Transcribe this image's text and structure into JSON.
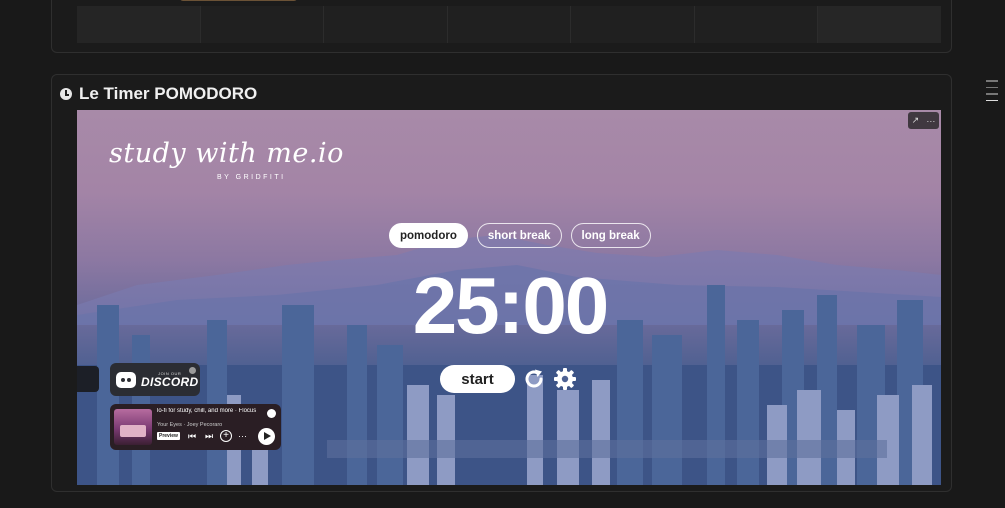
{
  "card": {
    "title": "Le Timer POMODORO"
  },
  "embed": {
    "logo_main": "study with me.io",
    "logo_sub": "BY GRIDFITI",
    "tools": {
      "expand_icon": "↗",
      "more_icon": "···"
    },
    "modes": [
      {
        "label": "pomodoro",
        "active": true
      },
      {
        "label": "short break",
        "active": false
      },
      {
        "label": "long break",
        "active": false
      }
    ],
    "timer": "25:00",
    "start_label": "start",
    "discord": {
      "small_text": "JOIN OUR",
      "big_text": "DISCORD"
    },
    "spotify": {
      "title": "lo-fi for study, chill, and more · Flocus",
      "artist": "Your Eyes · Joey Pecoraro",
      "preview": "Preview"
    }
  }
}
